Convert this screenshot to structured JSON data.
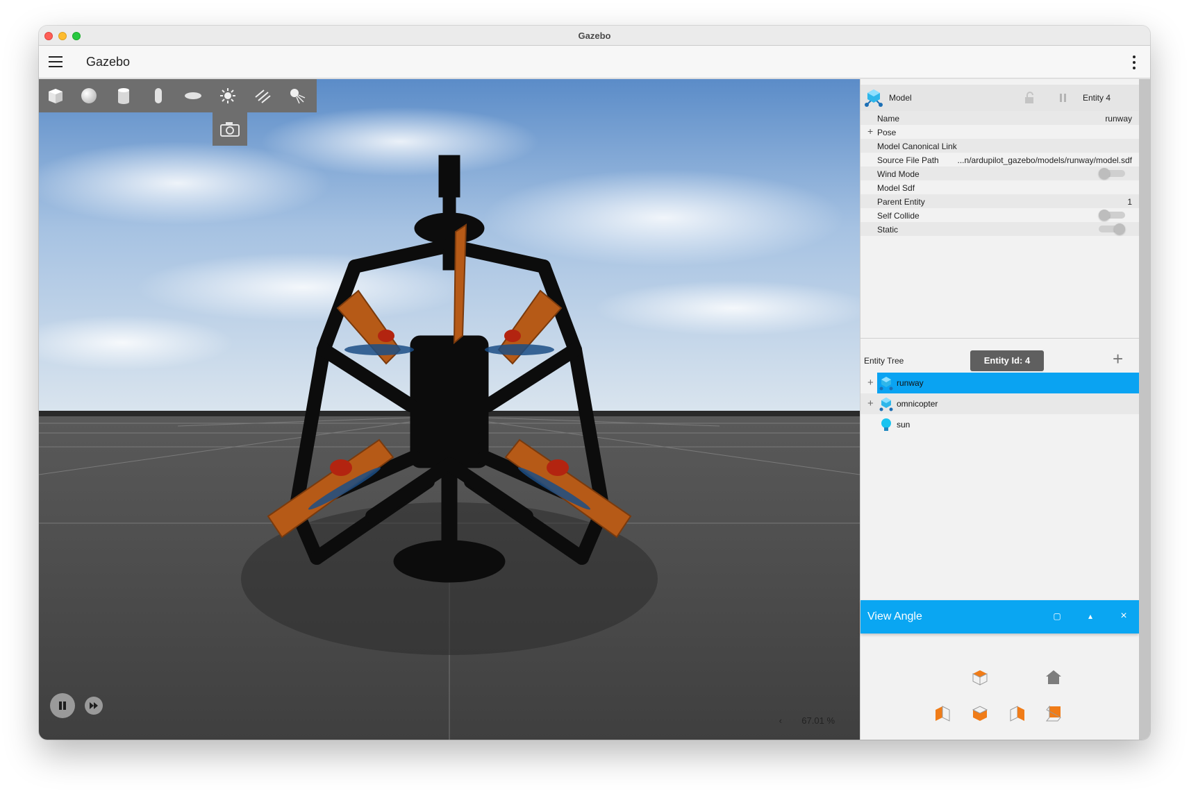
{
  "window": {
    "title": "Gazebo"
  },
  "appbar": {
    "title": "Gazebo"
  },
  "toolbar": {
    "tools": [
      "box-icon",
      "sphere-icon",
      "cylinder-icon",
      "capsule-icon",
      "ellipsoid-icon",
      "sun-icon",
      "directional-light-icon",
      "spot-light-icon"
    ]
  },
  "viewport": {
    "rtf_arrow": "‹",
    "real_time_factor": "67.01 %"
  },
  "component_inspector": {
    "type": "Model",
    "entity": "Entity 4",
    "properties": [
      {
        "label": "Name",
        "value": "runway"
      },
      {
        "label": "Pose",
        "value": ""
      },
      {
        "label": "Model Canonical Link",
        "value": ""
      },
      {
        "label": "Source File Path",
        "value": "...n/ardupilot_gazebo/models/runway/model.sdf"
      },
      {
        "label": "Wind Mode",
        "value": ""
      },
      {
        "label": "Model Sdf",
        "value": ""
      },
      {
        "label": "Parent Entity",
        "value": "1"
      },
      {
        "label": "Self Collide",
        "value": ""
      },
      {
        "label": "Static",
        "value": ""
      }
    ],
    "toggles": {
      "wind_mode": false,
      "self_collide": false,
      "static": true
    }
  },
  "entity_tree": {
    "title": "Entity Tree",
    "tooltip": "Entity Id: 4",
    "add_label": "+",
    "items": [
      {
        "label": "runway",
        "selected": true
      },
      {
        "label": "omnicopter",
        "selected": false
      },
      {
        "label": "sun",
        "selected": false
      }
    ]
  },
  "view_angle": {
    "title": "View Angle",
    "maximize": "▢",
    "collapse": "▴",
    "close": "×"
  },
  "colors": {
    "accent": "#0aa6f2",
    "selected_row": "#0aa3f2",
    "view_angle_orange": "#f07c18",
    "tooltip_bg": "#5f5f5f"
  }
}
